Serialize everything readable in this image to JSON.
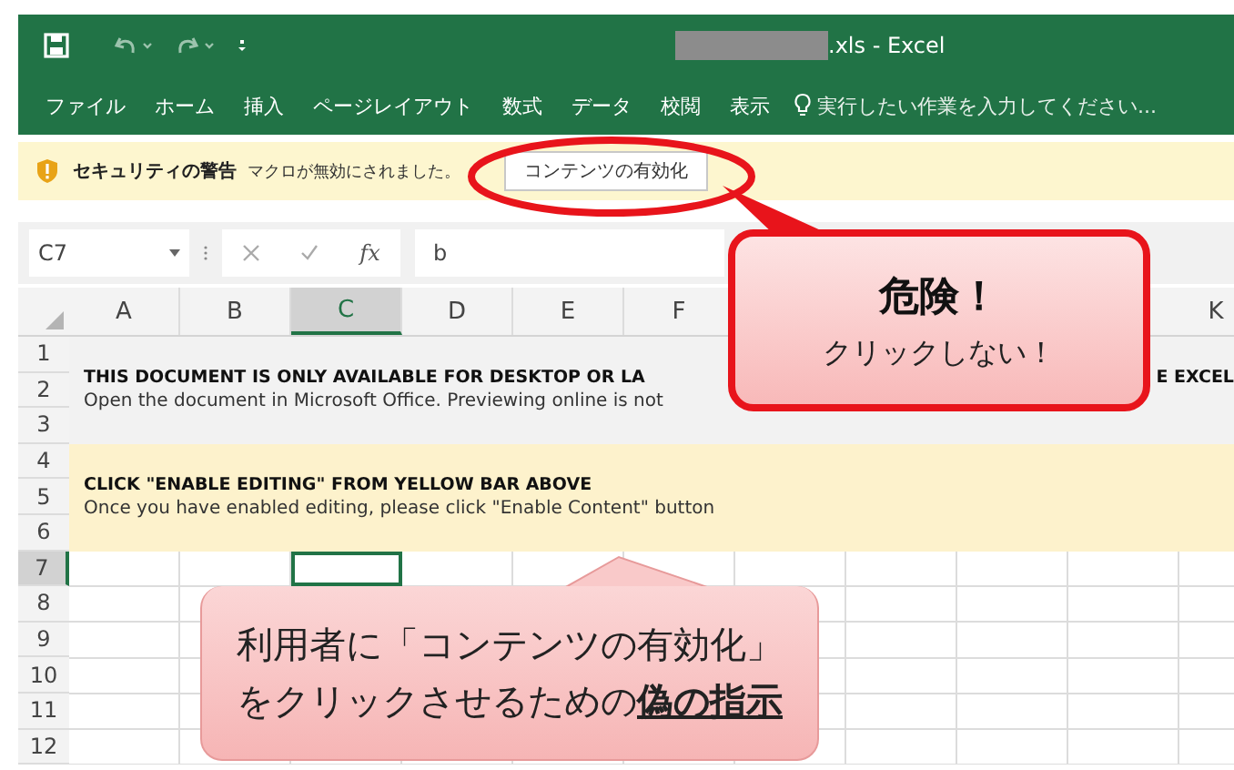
{
  "window": {
    "title": ".xls - Excel"
  },
  "ribbon_tabs": [
    {
      "label": "ファイル"
    },
    {
      "label": "ホーム"
    },
    {
      "label": "挿入"
    },
    {
      "label": "ページレイアウト"
    },
    {
      "label": "数式"
    },
    {
      "label": "データ"
    },
    {
      "label": "校閲"
    },
    {
      "label": "表示"
    }
  ],
  "search": {
    "placeholder": "実行したい作業を入力してください..."
  },
  "security_bar": {
    "title": "セキュリティの警告",
    "message": "マクロが無効にされました。",
    "button": "コンテンツの有効化"
  },
  "formula_bar": {
    "name_box": "C7",
    "function_label": "fx",
    "value": "b"
  },
  "columns": [
    {
      "label": "A",
      "selected": false
    },
    {
      "label": "B",
      "selected": false
    },
    {
      "label": "C",
      "selected": true
    },
    {
      "label": "D",
      "selected": false
    },
    {
      "label": "E",
      "selected": false
    },
    {
      "label": "F",
      "selected": false
    },
    {
      "label": "K",
      "selected": false
    }
  ],
  "rows": [
    {
      "label": "1",
      "selected": false
    },
    {
      "label": "2",
      "selected": false
    },
    {
      "label": "3",
      "selected": false
    },
    {
      "label": "4",
      "selected": false
    },
    {
      "label": "5",
      "selected": false
    },
    {
      "label": "6",
      "selected": false
    },
    {
      "label": "7",
      "selected": true
    },
    {
      "label": "8",
      "selected": false
    },
    {
      "label": "9",
      "selected": false
    },
    {
      "label": "10",
      "selected": false
    },
    {
      "label": "11",
      "selected": false
    },
    {
      "label": "12",
      "selected": false
    }
  ],
  "notice_1": {
    "heading_left": "THIS DOCUMENT IS ONLY AVAILABLE FOR DESKTOP OR LA",
    "heading_right": "E EXCEL",
    "body": "Open the document in Microsoft Office. Previewing online is not"
  },
  "notice_2": {
    "heading": "CLICK \"ENABLE EDITING\" FROM YELLOW BAR ABOVE",
    "body": "Once you have enabled editing, please click \"Enable Content\" button"
  },
  "warning_callout": {
    "title": "危険！",
    "text": "クリックしない！"
  },
  "note_callout": {
    "line_1": "利用者に「コンテンツの有効化」",
    "line_2": "をクリックさせるための**偽の指示**"
  }
}
